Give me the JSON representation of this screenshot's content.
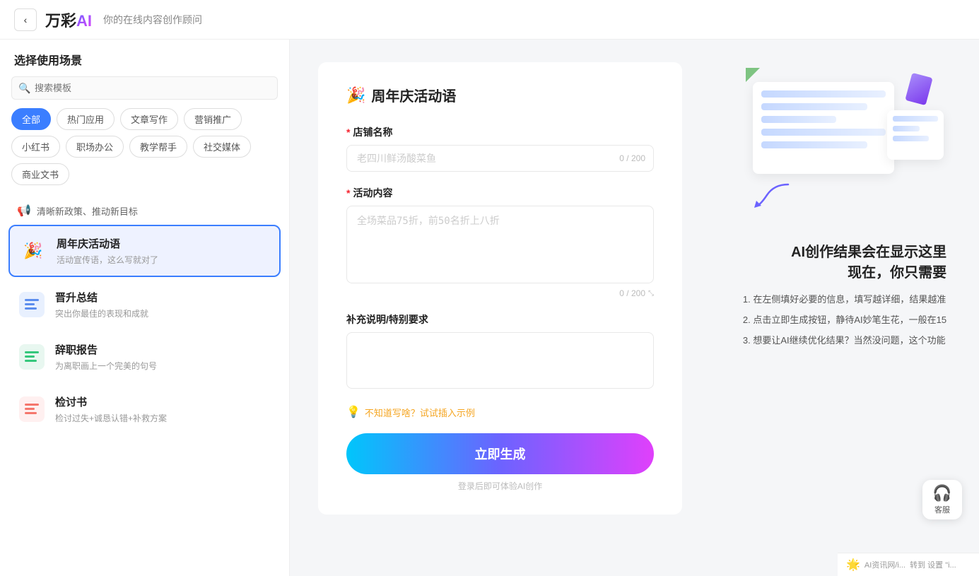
{
  "header": {
    "back_label": "‹",
    "logo_text": "万彩",
    "logo_ai": "AI",
    "subtitle": "你的在线内容创作顾问"
  },
  "sidebar": {
    "title": "选择使用场景",
    "search_placeholder": "搜索模板",
    "tags": [
      {
        "label": "全部",
        "active": true
      },
      {
        "label": "热门应用",
        "active": false
      },
      {
        "label": "文章写作",
        "active": false
      },
      {
        "label": "营销推广",
        "active": false
      },
      {
        "label": "小红书",
        "active": false
      },
      {
        "label": "职场办公",
        "active": false
      },
      {
        "label": "教学帮手",
        "active": false
      },
      {
        "label": "社交媒体",
        "active": false
      },
      {
        "label": "商业文书",
        "active": false
      }
    ],
    "announcement": {
      "icon": "📢",
      "text": "清晰新政策、推动新目标"
    },
    "templates": [
      {
        "id": "anniversary",
        "icon": "🎉",
        "name": "周年庆活动语",
        "desc": "活动宣传语，这么写就对了",
        "active": true
      },
      {
        "id": "promotion",
        "icon": "📋",
        "name": "晋升总结",
        "desc": "突出你最佳的表现和成就",
        "active": false
      },
      {
        "id": "resignation",
        "icon": "📝",
        "name": "辞职报告",
        "desc": "为离职画上一个完美的句号",
        "active": false
      },
      {
        "id": "reflection",
        "icon": "📄",
        "name": "检讨书",
        "desc": "检讨过失+诚恳认错+补救方案",
        "active": false
      }
    ]
  },
  "form": {
    "title": "周年庆活动语",
    "title_icon": "🎉",
    "store_name_label": "店铺名称",
    "store_name_placeholder": "老四川鲜汤酸菜鱼",
    "store_name_count": "0 / 200",
    "activity_content_label": "活动内容",
    "activity_content_placeholder": "全场菜品75折，前50名折上八折",
    "activity_content_count": "0 / 200",
    "supplement_label": "补充说明/特别要求",
    "supplement_placeholder": "",
    "hint_icon": "💡",
    "hint_text": "不知道写啥？试试插入示例",
    "generate_btn": "立即生成",
    "login_hint": "登录后即可体验AI创作"
  },
  "preview": {
    "title": "AI创作结果会在显示这里",
    "subtitle": "现在，你只需要",
    "steps": [
      "1. 在左侧填好必要的信息，填写越详细，结果越准",
      "2. 点击立即生成按钮，静待AI妙笔生花，一般在15",
      "3. 想要让AI继续优化结果？当然没问题，这个功能"
    ]
  },
  "customer_service": {
    "icon": "🎧",
    "label": "客服"
  },
  "bottom_banner": {
    "icon": "🌟",
    "text": "AI资讯网/i...",
    "sub": "转到 设置 \"i..."
  }
}
